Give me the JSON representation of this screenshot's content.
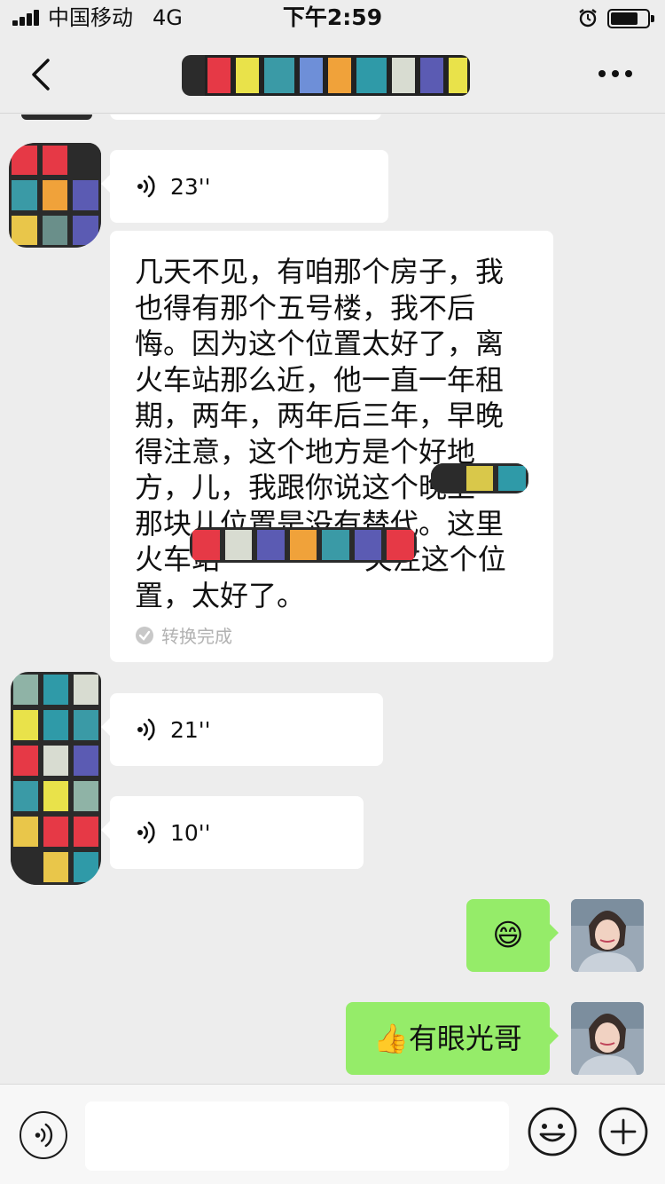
{
  "status_bar": {
    "carrier": "中国移动",
    "network": "4G",
    "time": "下午2:59"
  },
  "nav": {
    "title": "",
    "back_icon": "chevron-left-icon",
    "more_icon": "more-dots-icon"
  },
  "messages": {
    "voice_1": {
      "duration": "23''"
    },
    "transcript": {
      "text": "几天不见，有咱那个房子，我也得有那个五号楼，我不后悔。因为这个位置太好了，离火车站那么近，他一直一年租期，两年，两年后三年，早晚得注意，这个地方是个好地方，儿，我跟你说这个晚上        那块儿位置是没有替代。这里火车站                关注这个位置，太好了。",
      "status": "转换完成"
    },
    "voice_2": {
      "duration": "21''"
    },
    "voice_3": {
      "duration": "10''"
    },
    "sent_1": {
      "emoji": "😄"
    },
    "sent_2": {
      "text": "👍有眼光哥"
    }
  },
  "input_bar": {
    "placeholder": ""
  },
  "colors": {
    "background": "#ededed",
    "bubble_received": "#ffffff",
    "bubble_sent": "#95ec69",
    "secondary_text": "#b2b2b2"
  }
}
